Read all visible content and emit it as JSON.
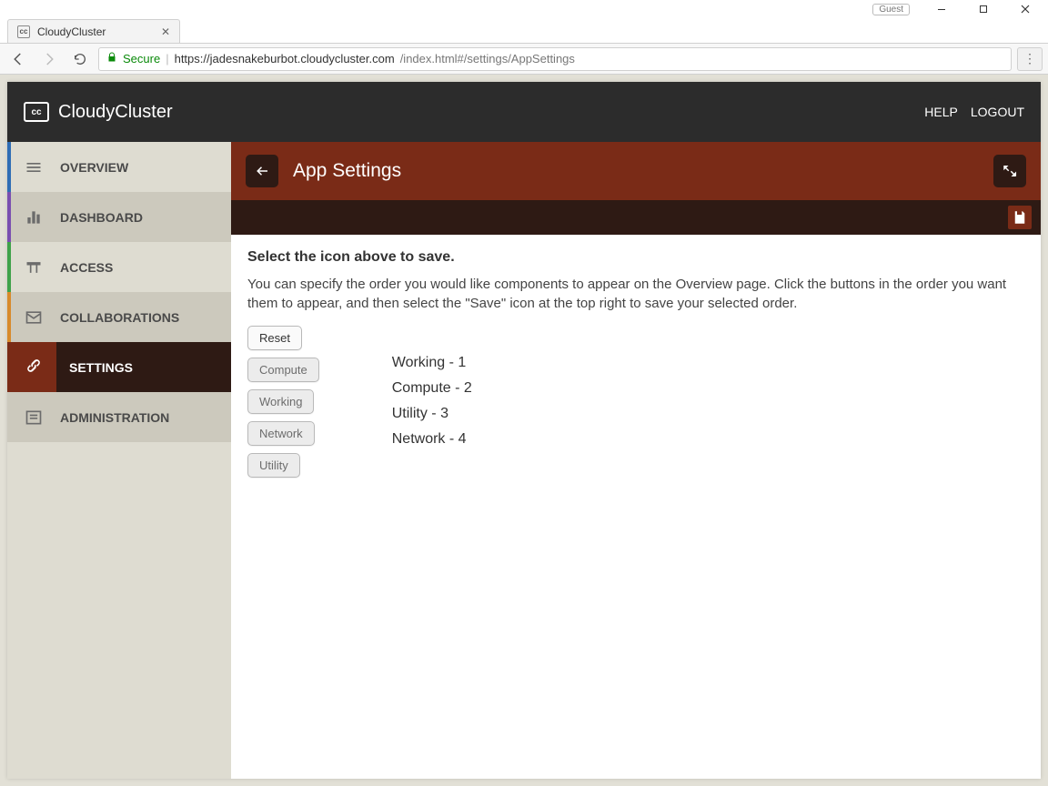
{
  "browser": {
    "guest_label": "Guest",
    "tab_title": "CloudyCluster",
    "secure_label": "Secure",
    "url_host": "https://jadesnakeburbot.cloudycluster.com",
    "url_path": "/index.html#/settings/AppSettings"
  },
  "header": {
    "brand": "CloudyCluster",
    "help": "HELP",
    "logout": "LOGOUT"
  },
  "sidebar": {
    "items": [
      {
        "label": "OVERVIEW"
      },
      {
        "label": "DASHBOARD"
      },
      {
        "label": "ACCESS"
      },
      {
        "label": "COLLABORATIONS"
      },
      {
        "label": "SETTINGS"
      },
      {
        "label": "ADMINISTRATION"
      }
    ]
  },
  "page": {
    "title": "App Settings",
    "save_hint": "Select the icon above to save.",
    "description": "You can specify the order you would like components to appear on the Overview page. Click the buttons in the order you want them to appear, and then select the \"Save\" icon at the top right to save your selected order.",
    "reset_label": "Reset",
    "component_buttons": [
      "Compute",
      "Working",
      "Network",
      "Utility"
    ],
    "order_list": [
      "Working - 1",
      "Compute - 2",
      "Utility - 3",
      "Network - 4"
    ]
  }
}
